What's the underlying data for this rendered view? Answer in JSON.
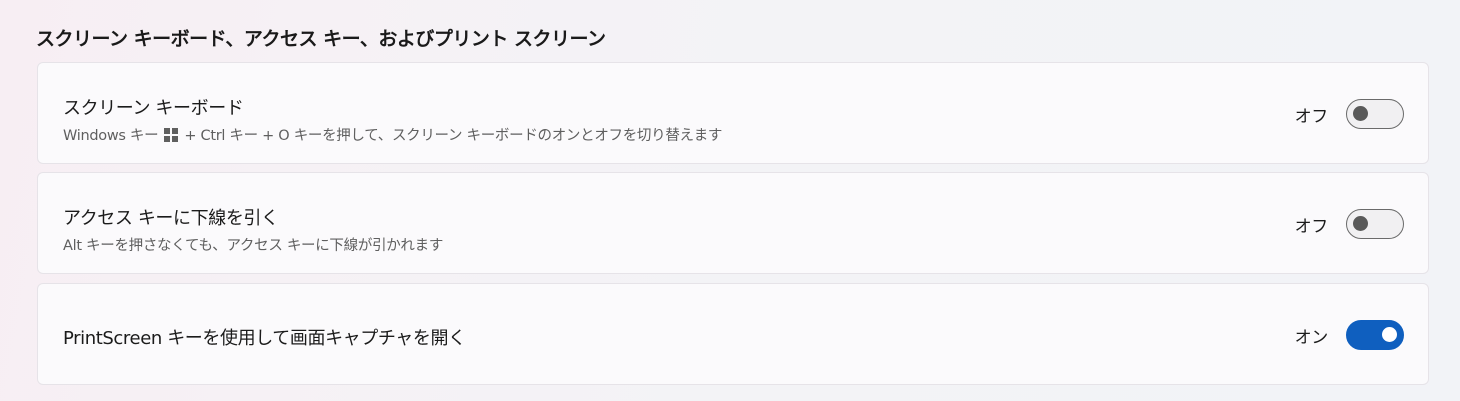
{
  "section": {
    "title": "スクリーン キーボード、アクセス キー、およびプリント スクリーン"
  },
  "settings": [
    {
      "title": "スクリーン キーボード",
      "description_before_icon": "Windows キー",
      "description_icon": "windows-logo-icon",
      "description_after_icon": "+ Ctrl キー + O キーを押して、スクリーン キーボードのオンとオフを切り替えます",
      "state_label": "オフ",
      "enabled": false
    },
    {
      "title": "アクセス キーに下線を引く",
      "description": "Alt キーを押さなくても、アクセス キーに下線が引かれます",
      "state_label": "オフ",
      "enabled": false
    },
    {
      "title": "PrintScreen キーを使用して画面キャプチャを開く",
      "state_label": "オン",
      "enabled": true
    }
  ],
  "colors": {
    "accent": "#0f5fbf",
    "toggle_off_knob": "#5a5a5a"
  }
}
